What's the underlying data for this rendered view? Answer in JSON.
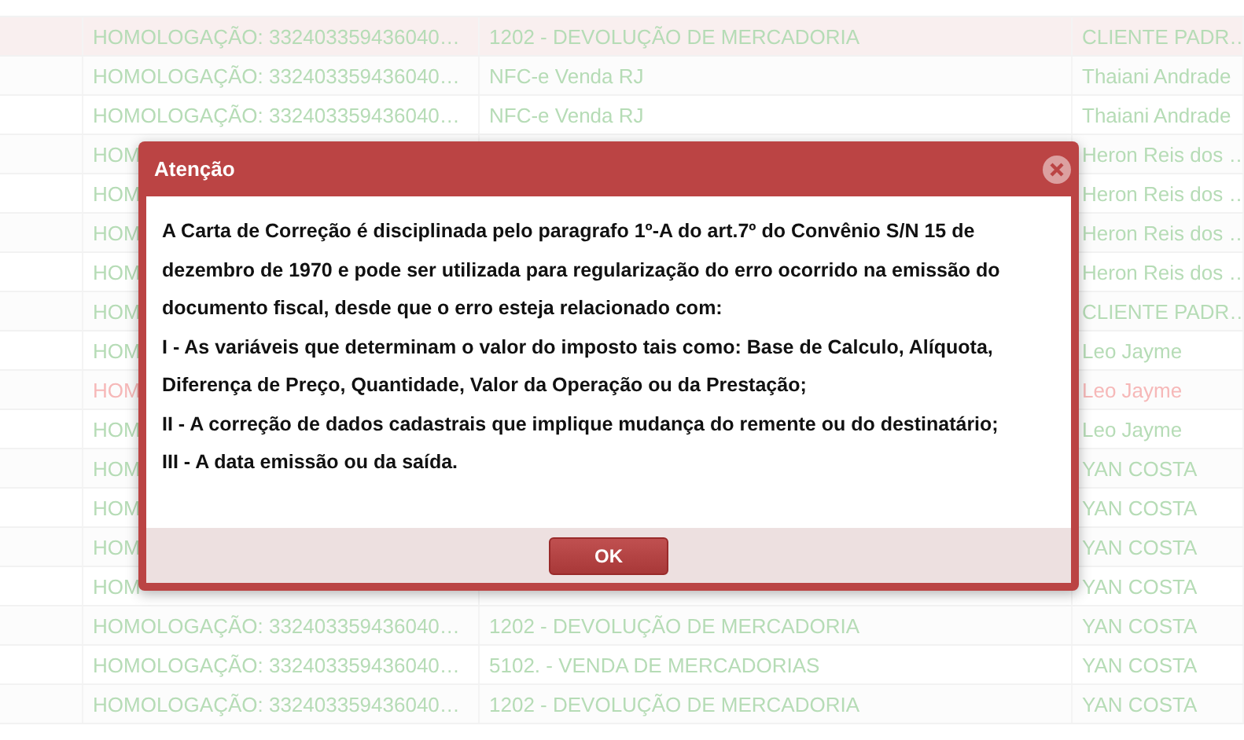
{
  "table": {
    "rows": [
      {
        "selected": true,
        "error": false,
        "cells": [
          "HOMOLOGAÇÃO: 332403359436040…",
          "1202 - DEVOLUÇÃO DE MERCADORIA",
          "CLIENTE PADR…"
        ]
      },
      {
        "selected": false,
        "error": false,
        "cells": [
          "HOMOLOGAÇÃO: 332403359436040…",
          "NFC-e Venda RJ",
          "Thaiani Andrade"
        ]
      },
      {
        "selected": false,
        "error": false,
        "cells": [
          "HOMOLOGAÇÃO: 332403359436040…",
          "NFC-e Venda RJ",
          "Thaiani Andrade"
        ]
      },
      {
        "selected": false,
        "error": false,
        "cells": [
          "HOM",
          "",
          "Heron Reis dos …"
        ]
      },
      {
        "selected": false,
        "error": false,
        "cells": [
          "HOM",
          "",
          "Heron Reis dos …"
        ]
      },
      {
        "selected": false,
        "error": false,
        "cells": [
          "HOM",
          "",
          "Heron Reis dos …"
        ]
      },
      {
        "selected": false,
        "error": false,
        "cells": [
          "HOM",
          "",
          "Heron Reis dos …"
        ]
      },
      {
        "selected": false,
        "error": false,
        "cells": [
          "HOM",
          "",
          "CLIENTE PADR…"
        ]
      },
      {
        "selected": false,
        "error": false,
        "cells": [
          "HOM",
          "",
          "Leo Jayme"
        ]
      },
      {
        "selected": false,
        "error": true,
        "cells": [
          "HOM",
          "",
          "Leo Jayme"
        ]
      },
      {
        "selected": false,
        "error": false,
        "cells": [
          "HOM",
          "",
          "Leo Jayme"
        ]
      },
      {
        "selected": false,
        "error": false,
        "cells": [
          "HOM",
          "",
          "YAN COSTA"
        ]
      },
      {
        "selected": false,
        "error": false,
        "cells": [
          "HOM",
          "",
          "YAN COSTA"
        ]
      },
      {
        "selected": false,
        "error": false,
        "cells": [
          "HOM",
          "",
          "YAN COSTA"
        ]
      },
      {
        "selected": false,
        "error": false,
        "cells": [
          "HOM",
          "",
          "YAN COSTA"
        ]
      },
      {
        "selected": false,
        "error": false,
        "cells": [
          "HOMOLOGAÇÃO: 332403359436040…",
          "1202 - DEVOLUÇÃO DE MERCADORIA",
          "YAN COSTA"
        ]
      },
      {
        "selected": false,
        "error": false,
        "cells": [
          "HOMOLOGAÇÃO: 332403359436040…",
          "5102. - VENDA DE MERCADORIAS",
          "YAN COSTA"
        ]
      },
      {
        "selected": false,
        "error": false,
        "cells": [
          "HOMOLOGAÇÃO: 332403359436040…",
          "1202 - DEVOLUÇÃO DE MERCADORIA",
          "YAN COSTA"
        ]
      }
    ]
  },
  "dialog": {
    "title": "Atenção",
    "paragraphs": [
      "A Carta de Correção é disciplinada pelo paragrafo 1º-A do art.7º do Convênio S/N 15 de dezembro de 1970 e pode ser utilizada para regularização do erro ocorrido na emissão do documento fiscal, desde que o erro esteja relacionado com:",
      "I - As variáveis que determinam o valor do imposto tais como: Base de Calculo, Alíquota, Diferença de Preço, Quantidade, Valor da Operação ou da Prestação;",
      "II - A correção de dados cadastrais que implique mudança do remente ou do destinatário;",
      "III - A data emissão ou da saída."
    ],
    "buttons": [
      "OK"
    ]
  }
}
